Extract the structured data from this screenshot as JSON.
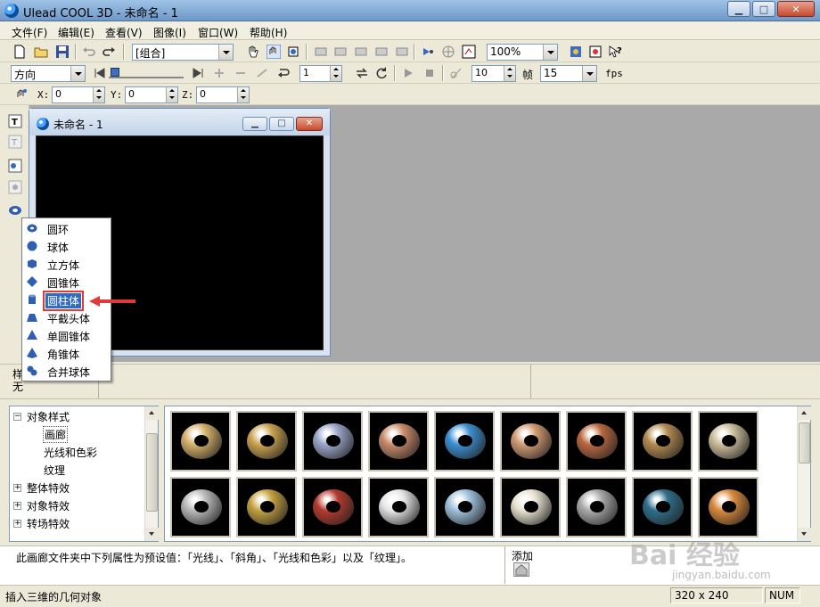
{
  "window": {
    "title": "Ulead COOL 3D - 未命名 - 1",
    "min_glyph": "▁",
    "max_glyph": "□",
    "close_glyph": "✕"
  },
  "menu": [
    "文件(F)",
    "编辑(E)",
    "查看(V)",
    "图像(I)",
    "窗口(W)",
    "帮助(H)"
  ],
  "toolbar1": {
    "object_combo": "[组合]",
    "zoom_combo": "100%"
  },
  "toolbar2": {
    "direction_combo": "方向",
    "frame_spin": "1",
    "fps_spin": "10",
    "frame_label": "帧",
    "fps_combo": "15",
    "fps_label": "fps"
  },
  "toolbar3": {
    "x_label": "X:",
    "x_value": "0",
    "y_label": "Y:",
    "y_value": "0",
    "z_label": "Z:",
    "z_value": "0"
  },
  "document": {
    "title": "未命名 - 1"
  },
  "geometry_menu": {
    "items": [
      {
        "label": "圆环",
        "icon": "torus-icon"
      },
      {
        "label": "球体",
        "icon": "sphere-icon"
      },
      {
        "label": "立方体",
        "icon": "cube-icon"
      },
      {
        "label": "圆锥体",
        "icon": "cone-icon"
      },
      {
        "label": "圆柱体",
        "icon": "cylinder-icon",
        "selected": true
      },
      {
        "label": "平截头体",
        "icon": "frustum-icon"
      },
      {
        "label": "单圆锥体",
        "icon": "single-cone-icon"
      },
      {
        "label": "角锥体",
        "icon": "pyramid-icon"
      },
      {
        "label": "合并球体",
        "icon": "merged-sphere-icon"
      }
    ]
  },
  "mid_panel": {
    "label1": "样",
    "label2": "无"
  },
  "tree": {
    "items": [
      {
        "label": "对象样式",
        "expander": "−",
        "level": 0
      },
      {
        "label": "画廊",
        "level": 1,
        "selected": true
      },
      {
        "label": "光线和色彩",
        "level": 1
      },
      {
        "label": "纹理",
        "level": 1
      },
      {
        "label": "整体特效",
        "expander": "+",
        "level": 0
      },
      {
        "label": "对象特效",
        "expander": "+",
        "level": 0
      },
      {
        "label": "转场特效",
        "expander": "+",
        "level": 0
      }
    ]
  },
  "gallery": {
    "row1": [
      "#d4b06a",
      "#c9a24e",
      "#9aa6c8",
      "#c88a6a",
      "#3b8fd0",
      "#d09a72",
      "#b9683f",
      "#b38a4f",
      "#cbbd9a"
    ],
    "row2": [
      "#b9b9b9",
      "#c4a140",
      "#b43a2e",
      "#e6e6e6",
      "#9ec1dc",
      "#e8e2d0",
      "#a9a9a9",
      "#2e6e8c",
      "#d9893c"
    ]
  },
  "description": {
    "text": "此画廊文件夹中下列属性为预设值：「光线」、「斜角」、「光线和色彩」以及「纹理」。",
    "add_label": "添加"
  },
  "status": {
    "message": "插入三维的几何对象",
    "size": "320 x 240",
    "num": "NUM"
  },
  "watermark": {
    "brand": "Bai 经验",
    "url": "jingyan.baidu.com"
  },
  "colors": {
    "accent": "#316ac5",
    "highlight_border": "#e03a3a",
    "canvas": "#000000"
  }
}
